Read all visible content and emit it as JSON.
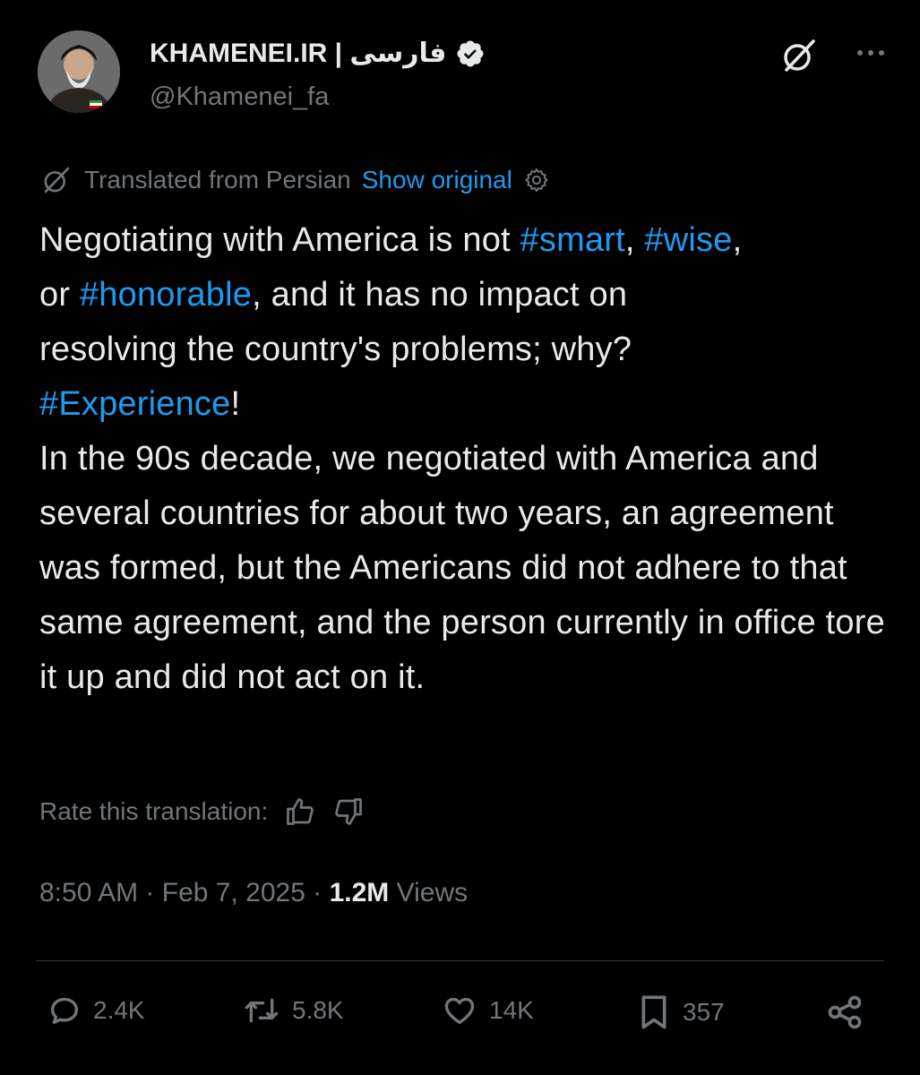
{
  "author": {
    "name": "KHAMENEI.IR | فارسی",
    "handle": "@Khamenei_fa",
    "verified": true,
    "accent_color": "#1d9bf0"
  },
  "header_icons": {
    "grok": "grok-icon",
    "more": "more-icon"
  },
  "translation": {
    "label": "Translated from Persian",
    "show_original": "Show original",
    "settings_icon": "gear-icon"
  },
  "tweet": {
    "line1_a": "Negotiating with America is not ",
    "tag_smart": "#smart",
    "sep1": ", ",
    "tag_wise": "#wise",
    "sep2": ",",
    "line2_a": "or ",
    "tag_honorable": "#honorable",
    "line2_b": ", and it has no impact on",
    "line3": "resolving the country's problems; why?",
    "tag_experience": "#Experience",
    "excl": "!",
    "paragraph2": "In the 90s decade, we negotiated with America and several countries for about two years, an agreement was formed, but the Americans did not adhere to that same agreement, and the person currently in office tore it up and did not act on it."
  },
  "rate": {
    "label": "Rate this translation:"
  },
  "meta": {
    "time": "8:50 AM",
    "dot": "·",
    "date": "Feb 7, 2025",
    "views_count": "1.2M",
    "views_label": "Views"
  },
  "actions": {
    "replies": "2.4K",
    "reposts": "5.8K",
    "likes": "14K",
    "bookmarks": "357"
  },
  "colors": {
    "background": "#000000",
    "text": "#e7e9ea",
    "muted": "#71767b",
    "link": "#1d9bf0"
  }
}
